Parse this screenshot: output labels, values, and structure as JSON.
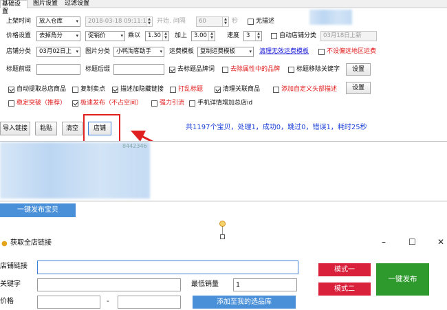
{
  "tabs": [
    "基础设置",
    "图片设置",
    "过滤设置"
  ],
  "row1": {
    "shelf_time_label": "上架时间",
    "shelf_time_value": "放入仓库",
    "datetime_value": "2018-03-18 09:11:19",
    "interval_label": "开始. 间隔",
    "interval_value": "60",
    "seconds_label": "秒",
    "no_desc_label": "无描述"
  },
  "row2": {
    "price_label": "价格设置",
    "price_rule": "去掉角分",
    "price_type": "促销价",
    "multiply_label": "乘以",
    "multiply_value": "1.30",
    "add_label": "加上",
    "add_value": "3.00",
    "speed_label": "速度",
    "speed_value": "3",
    "auto_category_label": "自动店铺分类",
    "auto_category_value": "03月18日上新"
  },
  "row3": {
    "shop_category_label": "店铺分类",
    "shop_category_value": "03月02日上",
    "image_category_label": "图片分类",
    "image_category_value": "小鸭淘客助手",
    "shipping_template_label": "运费模板",
    "shipping_template_value": "复制运费模板",
    "clear_templates_link": "清理无效运费模板",
    "no_remote_label": "不设偏远地区运费"
  },
  "row4": {
    "title_prefix_label": "标题前缀",
    "title_suffix_label": "标题后缀",
    "remove_brand_label": "去标题品牌词",
    "remove_attr_brand_label": "去除属性中的品牌",
    "title_remove_keyword_label": "标题移除关键字",
    "settings_label": "设置"
  },
  "row5": {
    "auto_extract_label": "自动提取总店商品",
    "copy_selling_label": "复制卖点",
    "desc_hidden_link_label": "描述加隐藏链接",
    "random_title_label": "打乱标题",
    "clean_related_label": "清理关联商品",
    "custom_header_label": "添加自定义头部描述",
    "settings_label": "设置"
  },
  "row6": {
    "stable_break_label": "稳定突破（推荐）",
    "fast_publish_label": "极速发布（不占空间）",
    "force_drain_label": "强力引流",
    "mobile_detail_label": "手机详情增加总店id"
  },
  "actions": {
    "import_label": "导入链接",
    "paste_label": "粘贴",
    "clear_label": "清空",
    "shop_label": "店铺",
    "status_text": "共1197个宝贝，处理1，成功0，跳过0，错误1，耗时25秒"
  },
  "log_partial_text": "8442346",
  "publish_button_label": "一键发布宝贝",
  "dialog": {
    "title": "获取全店链接",
    "shop_link_label": "店铺链接",
    "shop_link_value": "",
    "keyword_label": "关键字",
    "keyword_value": "",
    "min_sales_label": "最低销量",
    "min_sales_value": "1",
    "price_label": "价格",
    "price_min": "",
    "price_dash": "-",
    "price_max": "",
    "add_to_library_label": "添加至我的选品库",
    "mode1_label": "模式一",
    "mode2_label": "模式二",
    "publish_label": "一键发布",
    "minimize_glyph": "–",
    "maximize_glyph": "☐",
    "close_glyph": "✕"
  },
  "colors": {
    "highlight_red": "#e01818",
    "link_blue": "#1a1ad8",
    "status_blue": "#1a3fd8",
    "publish_blue": "#4a90d9",
    "mode_red": "#d9213c",
    "green": "#2e9a2e"
  }
}
